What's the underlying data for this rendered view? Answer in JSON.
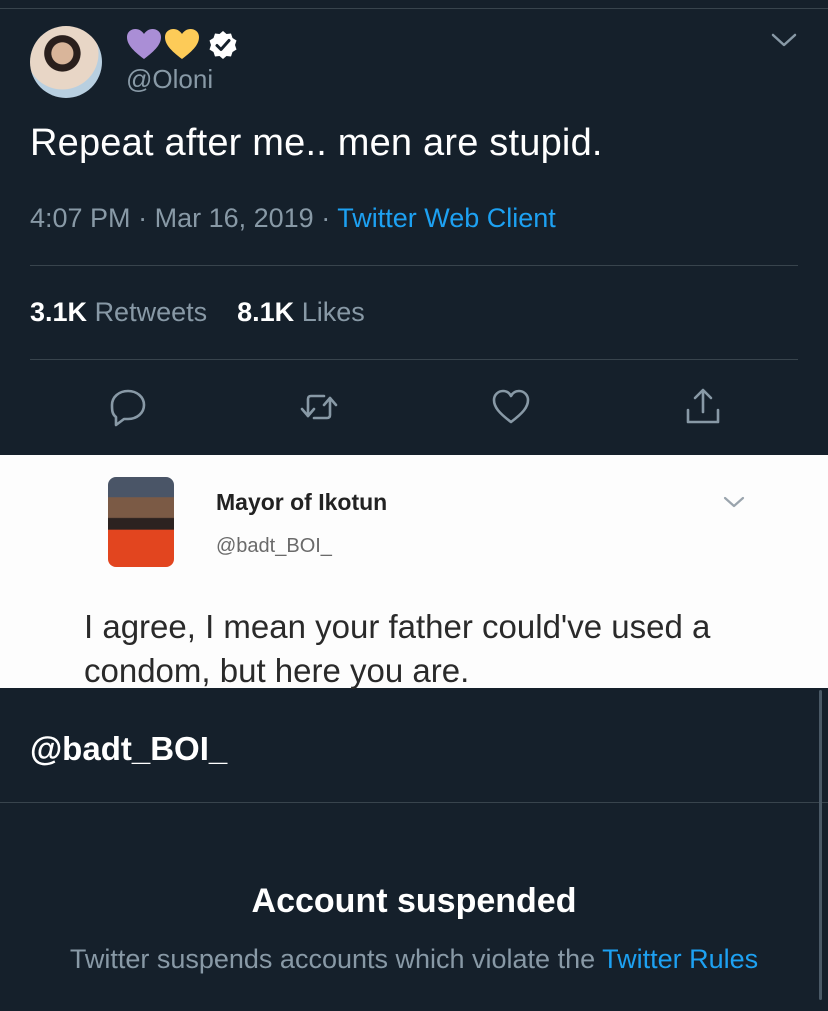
{
  "tweet": {
    "handle": "@Oloni",
    "display_name_icons": [
      "purple-heart-icon",
      "yellow-heart-icon"
    ],
    "verified": true,
    "text": "Repeat after me.. men are stupid.",
    "time": "4:07 PM",
    "separator": "·",
    "date": "Mar 16, 2019",
    "client": "Twitter Web Client",
    "retweets_count": "3.1K",
    "retweets_label": "Retweets",
    "likes_count": "8.1K",
    "likes_label": "Likes",
    "actions": [
      "reply-icon",
      "retweet-icon",
      "like-icon",
      "share-icon"
    ]
  },
  "reply_screenshot": {
    "name": "Mayor of Ikotun",
    "handle": "@badt_BOI_",
    "text": "I agree, I mean your father could've used a condom, but here you are."
  },
  "profile": {
    "handle": "@badt_BOI_",
    "status_title": "Account suspended",
    "status_message": "Twitter suspends accounts which violate the",
    "rules_link": "Twitter Rules"
  },
  "colors": {
    "background": "#15202b",
    "secondary_text": "#8899a6",
    "link": "#1da1f2",
    "divider": "#38444d"
  }
}
